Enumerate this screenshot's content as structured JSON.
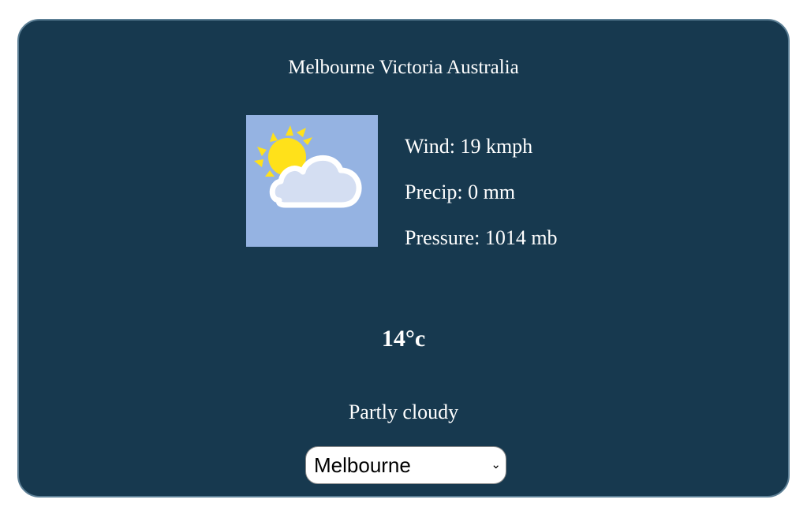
{
  "location": {
    "title": "Melbourne Victoria Australia"
  },
  "current": {
    "icon": "partly-cloudy-icon",
    "wind": "Wind: 19 kmph",
    "precip": "Precip: 0 mm",
    "pressure": "Pressure: 1014 mb",
    "temperature": "14°c",
    "condition": "Partly cloudy"
  },
  "city_select": {
    "selected": "Melbourne"
  },
  "colors": {
    "card_bg": "#17394f",
    "card_border": "#5c7f95",
    "icon_bg": "#95b3e2",
    "sun": "#ffe11a",
    "cloud": "#d4def2"
  }
}
